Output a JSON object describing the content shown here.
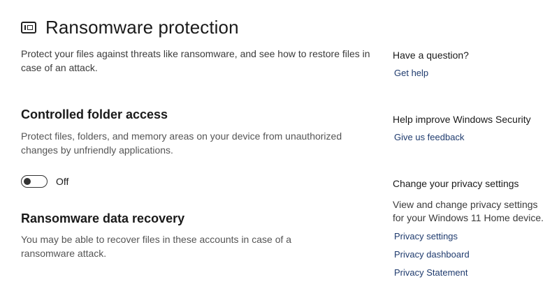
{
  "header": {
    "icon": "app-browser-icon",
    "title": "Ransomware protection"
  },
  "intro": "Protect your files against threats like ransomware, and see how to restore files in case of an attack.",
  "controlled_folder_access": {
    "title": "Controlled folder access",
    "description": "Protect files, folders, and memory areas on your device from unauthorized changes by unfriendly applications.",
    "toggle_state": "Off",
    "toggle_on": false
  },
  "data_recovery": {
    "title": "Ransomware data recovery",
    "description": "You may be able to recover files in these accounts in case of a ransomware attack."
  },
  "sidebar": {
    "question": {
      "heading": "Have a question?",
      "link": "Get help"
    },
    "improve": {
      "heading": "Help improve Windows Security",
      "link": "Give us feedback"
    },
    "privacy": {
      "heading": "Change your privacy settings",
      "text": "View and change privacy settings for your Windows 11 Home device.",
      "links": [
        "Privacy settings",
        "Privacy dashboard",
        "Privacy Statement"
      ]
    }
  },
  "colors": {
    "link": "#1f3b6e",
    "text": "#1a1a1a",
    "muted": "#555555"
  }
}
